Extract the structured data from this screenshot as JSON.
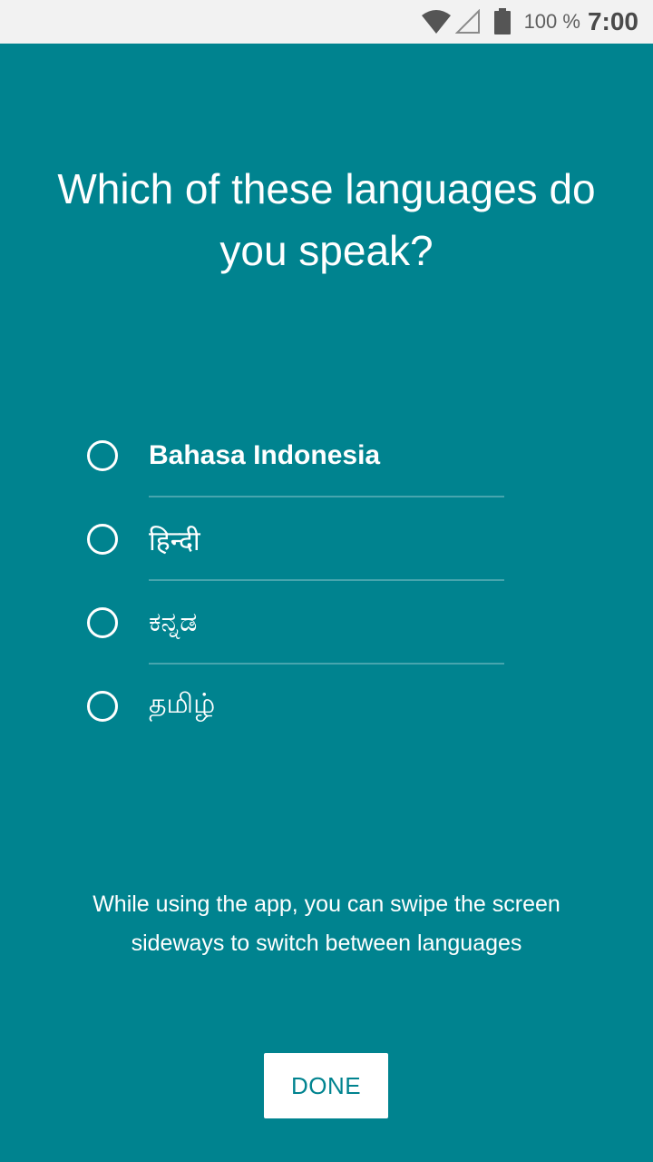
{
  "status_bar": {
    "battery_text": "100 %",
    "time": "7:00",
    "icons": [
      "wifi-icon",
      "signal-icon",
      "battery-icon"
    ]
  },
  "title": "Which of these languages do you speak?",
  "languages": [
    {
      "label": "Bahasa Indonesia",
      "selected": false
    },
    {
      "label": "हिन्दी",
      "selected": false
    },
    {
      "label": "ಕನ್ನಡ",
      "selected": false
    },
    {
      "label": "தமிழ்",
      "selected": false
    }
  ],
  "hint": "While using the app, you can swipe the screen sideways to switch between languages",
  "done_button": {
    "label": "DONE"
  },
  "colors": {
    "background": "#00838f",
    "status_bar": "#f2f2f2",
    "button_background": "#ffffff",
    "button_text": "#00838f"
  }
}
